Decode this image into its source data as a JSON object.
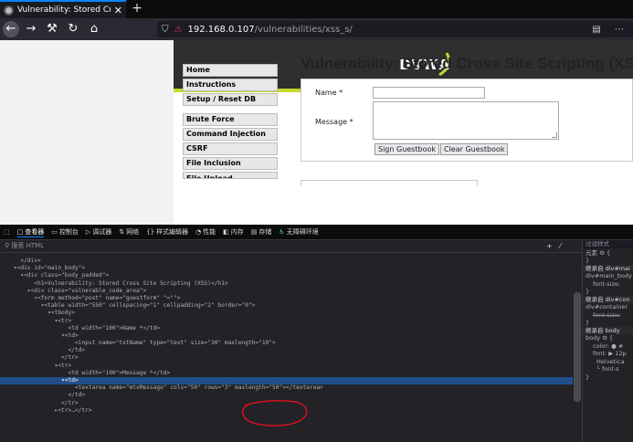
{
  "browser": {
    "tab_title": "Vulnerability: Stored Cross Si",
    "new_tab": "+",
    "url_host": "192.168.0.107",
    "url_path": "/vulnerabilities/xss_s/",
    "toolbar_right": "▤ ⋯"
  },
  "site": {
    "logo": "DVWA",
    "menu": [
      "Home",
      "Instructions",
      "Setup / Reset DB"
    ],
    "menu2": [
      "Brute Force",
      "Command Injection",
      "CSRF",
      "File Inclusion",
      "File Upload"
    ],
    "title": "Vulnerability: Stored Cross Site Scripting (XSS)",
    "name_label": "Name *",
    "message_label": "Message *",
    "sign_button": "Sign Guestbook",
    "clear_button": "Clear Guestbook"
  },
  "devtools": {
    "tabs": [
      "查看器",
      "控制台",
      "调试器",
      "网络",
      "样式编辑器",
      "性能",
      "内存",
      "存储",
      "无障碍环境"
    ],
    "search_placeholder": "搜索 HTML",
    "styles_header": "过滤样式",
    "styles_lines": [
      "元素 ⚙ {",
      "}",
      "继承自 div#mai",
      "div#main_body",
      "font-size:",
      "}",
      "继承自 div#con",
      "div#container",
      "font-size:",
      "}",
      "继承自 body",
      "body ⚙ {",
      "color: ● #",
      "font: ▶ 12p",
      "Helvetica",
      "└ font-s",
      "}"
    ],
    "html_lines": [
      "      </div>",
      "    ▾<div id=\"main_body\">",
      "      ▾<div class=\"body_padded\">",
      "          <h1>Vulnerability: Stored Cross Site Scripting (XSS)</h1>",
      "        ▾<div class=\"vulnerable_code_area\">",
      "          ▾<form method=\"post\" name=\"guestform\" \"=\"\">",
      "            ▾<table width=\"550\" cellspacing=\"1\" cellpadding=\"2\" border=\"0\">",
      "              ▾<tbody>",
      "                ▾<tr>",
      "                    <td width=\"100\">Name *</td>",
      "                  ▾<td>",
      "                      <input name=\"txtName\" type=\"text\" size=\"30\" maxlength=\"10\">",
      "                    </td>",
      "                  </tr>",
      "                ▾<tr>",
      "                    <td width=\"100\">Message *</td>",
      "                  ▾<td>",
      "                      <textarea name=\"mtxMessage\" cols=\"50\" rows=\"3\" maxlength=\"50\"></textarea>",
      "                    </td>",
      "                  </tr>",
      "                ▸<tr>…</tr>"
    ],
    "selected_line": 16
  }
}
